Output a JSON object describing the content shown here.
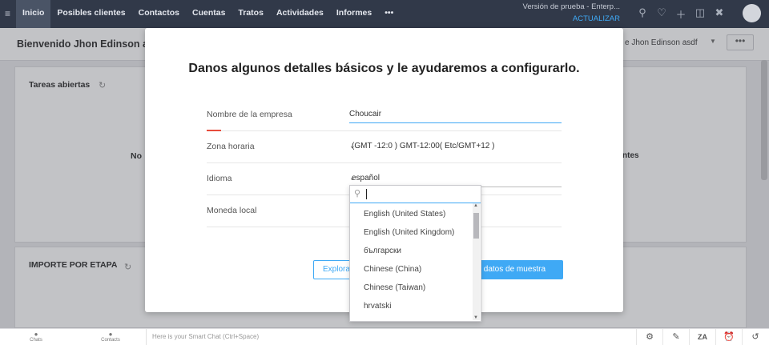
{
  "topbar": {
    "nav": [
      "Inicio",
      "Posibles clientes",
      "Contactos",
      "Cuentas",
      "Tratos",
      "Actividades",
      "Informes"
    ],
    "more": "•••",
    "trial_text": "Versión de prueba - Enterp...",
    "upgrade": "ACTUALIZAR"
  },
  "header": {
    "welcome": "Bienvenido Jhon Edinson asdf",
    "user_right": "e Jhon Edinson asdf",
    "more_button": "•••"
  },
  "dashboard": {
    "card1_title": "Tareas abiertas",
    "card1_side_left": "No",
    "card1_side_right": "ntes",
    "card2_title": "IMPORTE POR ETAPA"
  },
  "modal": {
    "heading": "Danos algunos detalles básicos y le ayudaremos a configurarlo.",
    "fields": [
      {
        "label": "Nombre de la empresa",
        "value": "Choucair"
      },
      {
        "label": "Zona horaria",
        "value": "(GMT -12:0 ) GMT-12:00( Etc/GMT+12 )"
      },
      {
        "label": "Idioma",
        "value": "español"
      },
      {
        "label": "Moneda local",
        "value": ""
      }
    ],
    "explore_button": "Explora",
    "sample_button": "s datos de muestra"
  },
  "language_dropdown": {
    "options": [
      "English (United States)",
      "English (United Kingdom)",
      "български",
      "Chinese (China)",
      "Chinese (Taiwan)",
      "hrvatski"
    ]
  },
  "bottombar": {
    "chats": "Chats",
    "contacts": "Contacts",
    "smart_chat_placeholder": "Here is your Smart Chat (Ctrl+Space)"
  }
}
